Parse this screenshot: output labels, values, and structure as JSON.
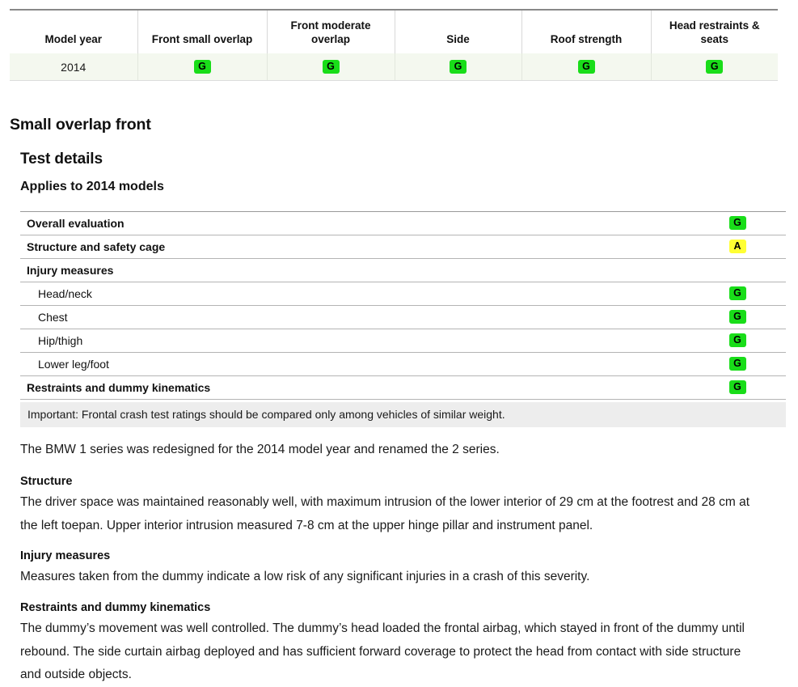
{
  "summary": {
    "columns": [
      "Model year",
      "Front small overlap",
      "Front moderate overlap",
      "Side",
      "Roof strength",
      "Head restraints & seats"
    ],
    "row": {
      "model_year": "2014",
      "front_small_overlap": "G",
      "front_moderate_overlap": "G",
      "side": "G",
      "roof_strength": "G",
      "head_restraints_seats": "G"
    }
  },
  "section": {
    "title": "Small overlap front",
    "subtitle": "Test details",
    "applies_to": "Applies to 2014 models"
  },
  "detail_rows": [
    {
      "label": "Overall evaluation",
      "rating": "G",
      "level": 0
    },
    {
      "label": "Structure and safety cage",
      "rating": "A",
      "level": 0
    },
    {
      "label": "Injury measures",
      "rating": "",
      "level": 0
    },
    {
      "label": "Head/neck",
      "rating": "G",
      "level": 1
    },
    {
      "label": "Chest",
      "rating": "G",
      "level": 1
    },
    {
      "label": "Hip/thigh",
      "rating": "G",
      "level": 1
    },
    {
      "label": "Lower leg/foot",
      "rating": "G",
      "level": 1
    },
    {
      "label": "Restraints and dummy kinematics",
      "rating": "G",
      "level": 0
    }
  ],
  "note": "Important: Frontal crash test ratings should be compared only among vehicles of similar weight.",
  "body": {
    "intro": "The BMW 1 series was redesigned for the 2014 model year and renamed the 2 series.",
    "structure_heading": "Structure",
    "structure_text": "The driver space was maintained reasonably well, with maximum intrusion of the lower interior of 29 cm at the footrest and 28 cm at the left toepan. Upper interior intrusion measured 7-8 cm at the upper hinge pillar and instrument panel.",
    "injury_heading": "Injury measures",
    "injury_text": "Measures taken from the dummy indicate a low risk of any significant injuries in a crash of this severity.",
    "restraints_heading": "Restraints and dummy kinematics",
    "restraints_text": "The dummy’s movement was well controlled. The dummy’s head loaded the frontal airbag, which stayed in front of the dummy until rebound. The side curtain airbag deployed and has sufficient forward coverage to protect the head from contact with side structure and outside objects."
  },
  "colors": {
    "good": "#19dd19",
    "acceptable": "#ffff33",
    "marginal": "#ff9900",
    "poor": "#ff2222",
    "note_bg": "#ededed",
    "row_bg": "#f4f8ef"
  }
}
